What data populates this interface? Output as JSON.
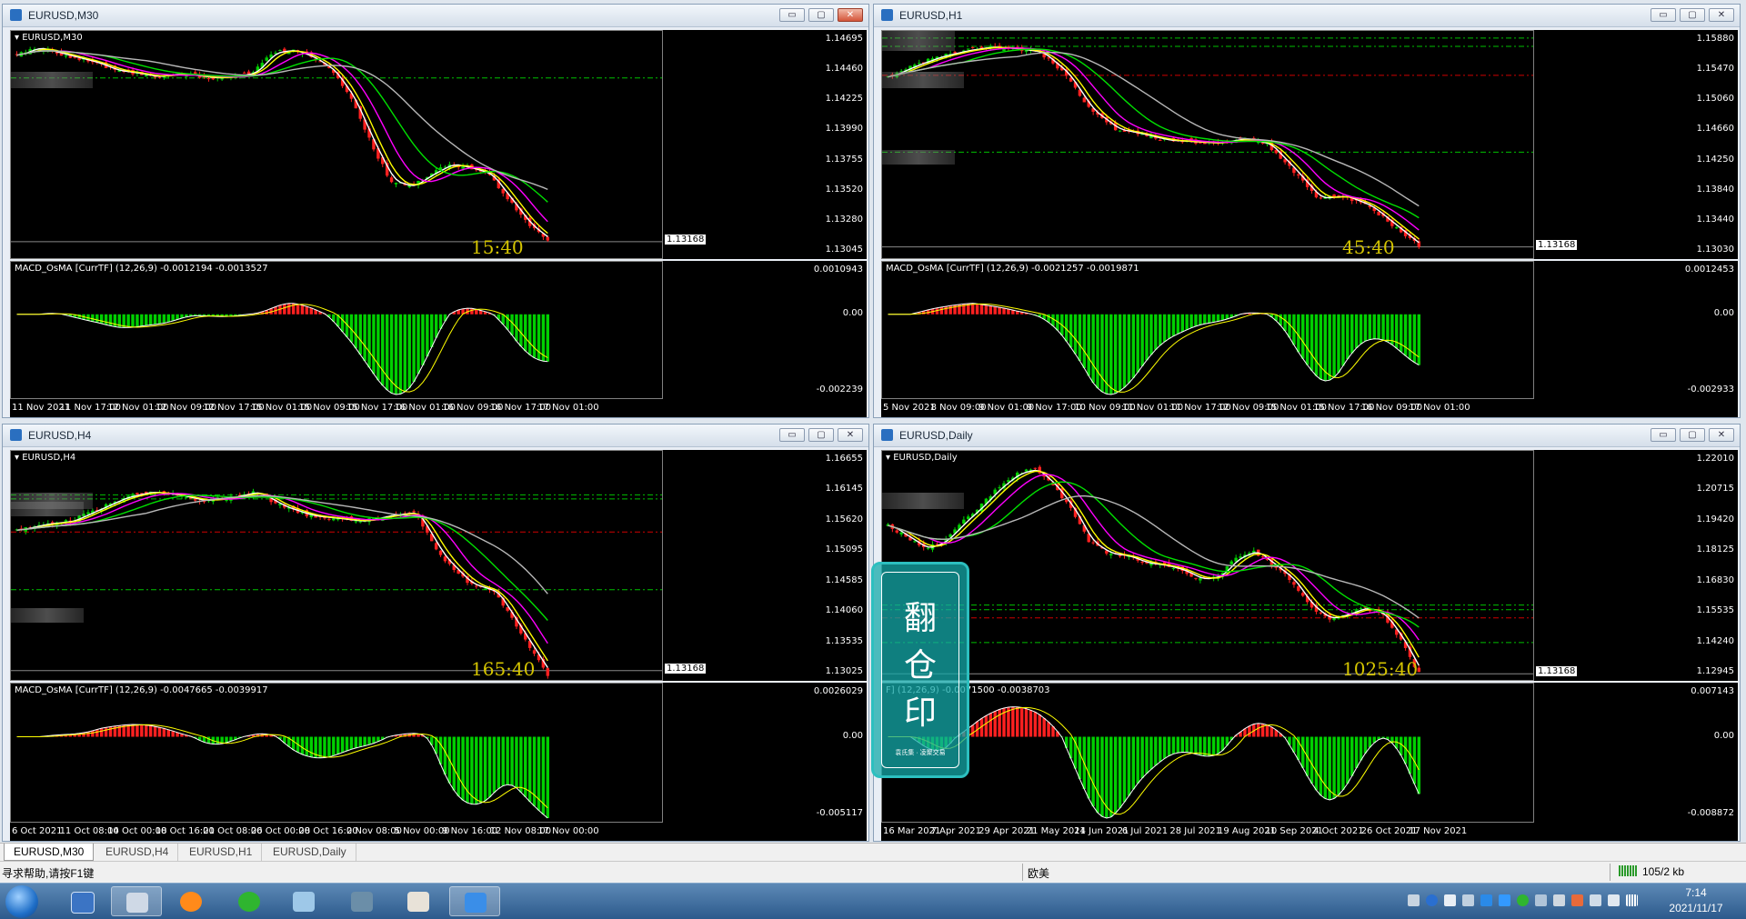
{
  "windows": [
    {
      "id": "m30",
      "title": "EURUSD,M30",
      "chart_label": "EURUSD,M30",
      "indicator_label": "MACD_OsMA [CurrTF] (12,26,9) -0.0012194 -0.0013527",
      "price_ticks": [
        "1.14695",
        "1.14460",
        "1.14225",
        "1.13990",
        "1.13755",
        "1.13520",
        "1.13280",
        "1.13045"
      ],
      "current_price": "1.13168",
      "macd_ticks": [
        "0.0010943",
        "0.00",
        "-0.002239"
      ],
      "countdown": "15:40",
      "time_ticks": [
        "11 Nov 2021",
        "11 Nov 17:00",
        "12 Nov 01:00",
        "12 Nov 09:00",
        "12 Nov 17:00",
        "15 Nov 01:00",
        "15 Nov 09:00",
        "15 Nov 17:00",
        "16 Nov 01:00",
        "16 Nov 09:00",
        "16 Nov 17:00",
        "17 Nov 01:00"
      ]
    },
    {
      "id": "h1",
      "title": "EURUSD,H1",
      "chart_label": "",
      "indicator_label": "MACD_OsMA [CurrTF] (12,26,9) -0.0021257 -0.0019871",
      "price_ticks": [
        "1.15880",
        "1.15470",
        "1.15060",
        "1.14660",
        "1.14250",
        "1.13840",
        "1.13440",
        "1.13030"
      ],
      "current_price": "1.13168",
      "macd_ticks": [
        "0.0012453",
        "0.00",
        "-0.002933"
      ],
      "countdown": "45:40",
      "time_ticks": [
        "5 Nov 2021",
        "8 Nov 09:00",
        "9 Nov 01:00",
        "9 Nov 17:00",
        "10 Nov 09:00",
        "11 Nov 01:00",
        "11 Nov 17:00",
        "12 Nov 09:00",
        "15 Nov 01:00",
        "15 Nov 17:00",
        "16 Nov 09:00",
        "17 Nov 01:00"
      ]
    },
    {
      "id": "h4",
      "title": "EURUSD,H4",
      "chart_label": "EURUSD,H4",
      "indicator_label": "MACD_OsMA [CurrTF] (12,26,9) -0.0047665 -0.0039917",
      "price_ticks": [
        "1.16655",
        "1.16145",
        "1.15620",
        "1.15095",
        "1.14585",
        "1.14060",
        "1.13535",
        "1.13025"
      ],
      "current_price": "1.13168",
      "macd_ticks": [
        "0.0026029",
        "0.00",
        "-0.005117"
      ],
      "countdown": "165:40",
      "time_ticks": [
        "6 Oct 2021",
        "11 Oct 08:00",
        "14 Oct 00:00",
        "18 Oct 16:00",
        "21 Oct 08:00",
        "26 Oct 00:00",
        "28 Oct 16:00",
        "2 Nov 08:00",
        "5 Nov 00:00",
        "9 Nov 16:00",
        "12 Nov 08:00",
        "17 Nov 00:00"
      ]
    },
    {
      "id": "daily",
      "title": "EURUSD,Daily",
      "chart_label": "EURUSD,Daily",
      "indicator_label": "F] (12,26,9) -0.0071500 -0.0038703",
      "price_ticks": [
        "1.22010",
        "1.20715",
        "1.19420",
        "1.18125",
        "1.16830",
        "1.15535",
        "1.14240",
        "1.12945"
      ],
      "current_price": "1.13168",
      "macd_ticks": [
        "0.007143",
        "0.00",
        "-0.008872"
      ],
      "countdown": "1025:40",
      "time_ticks": [
        "16 Mar 2021",
        "7 Apr 2021",
        "29 Apr 2021",
        "21 May 2021",
        "14 Jun 2021",
        "6 Jul 2021",
        "28 Jul 2021",
        "19 Aug 2021",
        "10 Sep 2021",
        "4 Oct 2021",
        "26 Oct 2021",
        "17 Nov 2021"
      ]
    }
  ],
  "tabs": [
    "EURUSD,M30",
    "EURUSD,H4",
    "EURUSD,H1",
    "EURUSD,Daily"
  ],
  "status": {
    "help": "寻求帮助,请按F1键",
    "profile": "欧美",
    "traffic": "105/2 kb"
  },
  "stamp": {
    "line1": "翻",
    "line2": "仓",
    "line3": "印",
    "small": "袁氏集 · 凌聚交易"
  },
  "clock": {
    "time": "7:14",
    "date": "2021/11/17"
  },
  "colors": {
    "bull": "#00d000",
    "bear": "#ff2020",
    "ma_white": "#ffffff",
    "ma_yellow": "#ffff00",
    "ma_magenta": "#ff00ff",
    "ma_green": "#00e000",
    "ma_gray": "#b8b8b8",
    "level_green": "#00c000",
    "level_red": "#d00000"
  },
  "chart_data": [
    {
      "type": "candlestick",
      "title": "EURUSD,M30",
      "closes": [
        1.1464,
        1.147,
        1.1466,
        1.1462,
        1.1458,
        1.1452,
        1.145,
        1.1447,
        1.1449,
        1.1448,
        1.1446,
        1.1447,
        1.145,
        1.1466,
        1.1468,
        1.1462,
        1.1452,
        1.143,
        1.1395,
        1.1365,
        1.136,
        1.137,
        1.1378,
        1.1375,
        1.137,
        1.135,
        1.133,
        1.1318
      ],
      "ylim": [
        1.13045,
        1.1481
      ],
      "levels_green": [
        1.1446
      ],
      "levels_red": []
    },
    {
      "type": "candlestick",
      "title": "EURUSD,H1",
      "closes": [
        1.1545,
        1.156,
        1.1572,
        1.158,
        1.1585,
        1.1583,
        1.1578,
        1.155,
        1.15,
        1.1475,
        1.1468,
        1.146,
        1.1458,
        1.1456,
        1.1462,
        1.1455,
        1.142,
        1.1382,
        1.1385,
        1.1372,
        1.1345,
        1.1318
      ],
      "ylim": [
        1.1303,
        1.1603
      ],
      "levels_green": [
        1.1597,
        1.1586,
        1.1444
      ],
      "levels_red": [
        1.1547
      ]
    },
    {
      "type": "candlestick",
      "title": "EURUSD,H4",
      "closes": [
        1.1555,
        1.1565,
        1.157,
        1.159,
        1.161,
        1.162,
        1.1615,
        1.1605,
        1.161,
        1.162,
        1.1595,
        1.158,
        1.1575,
        1.157,
        1.158,
        1.1585,
        1.151,
        1.1465,
        1.145,
        1.138,
        1.131
      ],
      "ylim": [
        1.13025,
        1.1685
      ],
      "levels_green": [
        1.1615,
        1.1608,
        1.1454
      ],
      "levels_red": [
        1.1552
      ]
    },
    {
      "type": "candlestick",
      "title": "EURUSD,Daily",
      "closes": [
        1.195,
        1.19,
        1.185,
        1.188,
        1.196,
        1.203,
        1.211,
        1.217,
        1.219,
        1.212,
        1.202,
        1.188,
        1.183,
        1.182,
        1.179,
        1.178,
        1.176,
        1.172,
        1.173,
        1.181,
        1.184,
        1.178,
        1.172,
        1.161,
        1.155,
        1.157,
        1.16,
        1.157,
        1.146,
        1.1318
      ],
      "ylim": [
        1.12945,
        1.2256
      ],
      "levels_green": [
        1.161,
        1.159,
        1.145
      ],
      "levels_red": [
        1.1555
      ]
    }
  ]
}
